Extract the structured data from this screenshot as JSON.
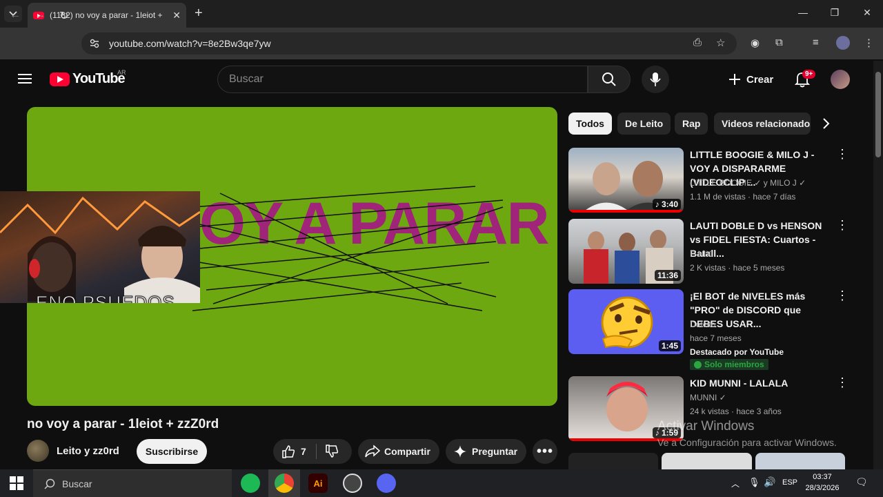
{
  "browser": {
    "tab_title": "(1182) no voy a parar - 1leiot +",
    "url": "youtube.com/watch?v=8e2Bw3qe7yw"
  },
  "header": {
    "logo_text": "YouTube",
    "country": "AR",
    "search_placeholder": "Buscar",
    "create_label": "Crear",
    "notifications_badge": "9+"
  },
  "player": {
    "overlay_text": "OY A PARAR",
    "cam_caption": "ENO PSUEDOS"
  },
  "video": {
    "title": "no voy a parar - 1leiot + zzZ0rd",
    "channel": "Leito y zz0rd",
    "subscribe_label": "Suscribirse",
    "likes": "7",
    "share_label": "Compartir",
    "ask_label": "Preguntar"
  },
  "chips": [
    "Todos",
    "De Leito",
    "Rap",
    "Videos relacionados"
  ],
  "recommendations": [
    {
      "title": "LITTLE BOOGIE & MILO J - VOY A DISPARARME (VIDEOCLIP ...",
      "channel": "LITTLE BOOGIE ✓ y MILO J ✓",
      "meta": "1.1 M de vistas · hace 7 días",
      "duration": "♪ 3:40"
    },
    {
      "title": "LAUTI DOBLE D vs HENSON vs FIDEL FIESTA: Cuartos - Batall...",
      "channel": "F-NIX",
      "meta": "2 K vistas · hace 5 meses",
      "duration": "11:36"
    },
    {
      "title": "¡El BOT de NIVELES más \"PRO\" de DISCORD que DEBES USAR...",
      "channel": "Dotcito",
      "meta": "hace 7 meses",
      "featured": "Destacado por YouTube",
      "members": "Solo miembros",
      "duration": "1:45"
    },
    {
      "title": "KID MUNNI - LALALA",
      "channel": "MUNNI ✓",
      "meta": "24 k vistas · hace 3 años",
      "duration": "♪ 1:59"
    }
  ],
  "windows_watermark": {
    "line1": "Activar Windows",
    "line2": "Ve a Configuración para activar Windows."
  },
  "taskbar": {
    "search_label": "Buscar",
    "lang": "ESP",
    "time": "03:37",
    "date": "28/3/2026"
  },
  "colors": {
    "accent_red": "#ff0033",
    "player_green": "#6ea811",
    "overlay_magenta": "#a0247a"
  }
}
